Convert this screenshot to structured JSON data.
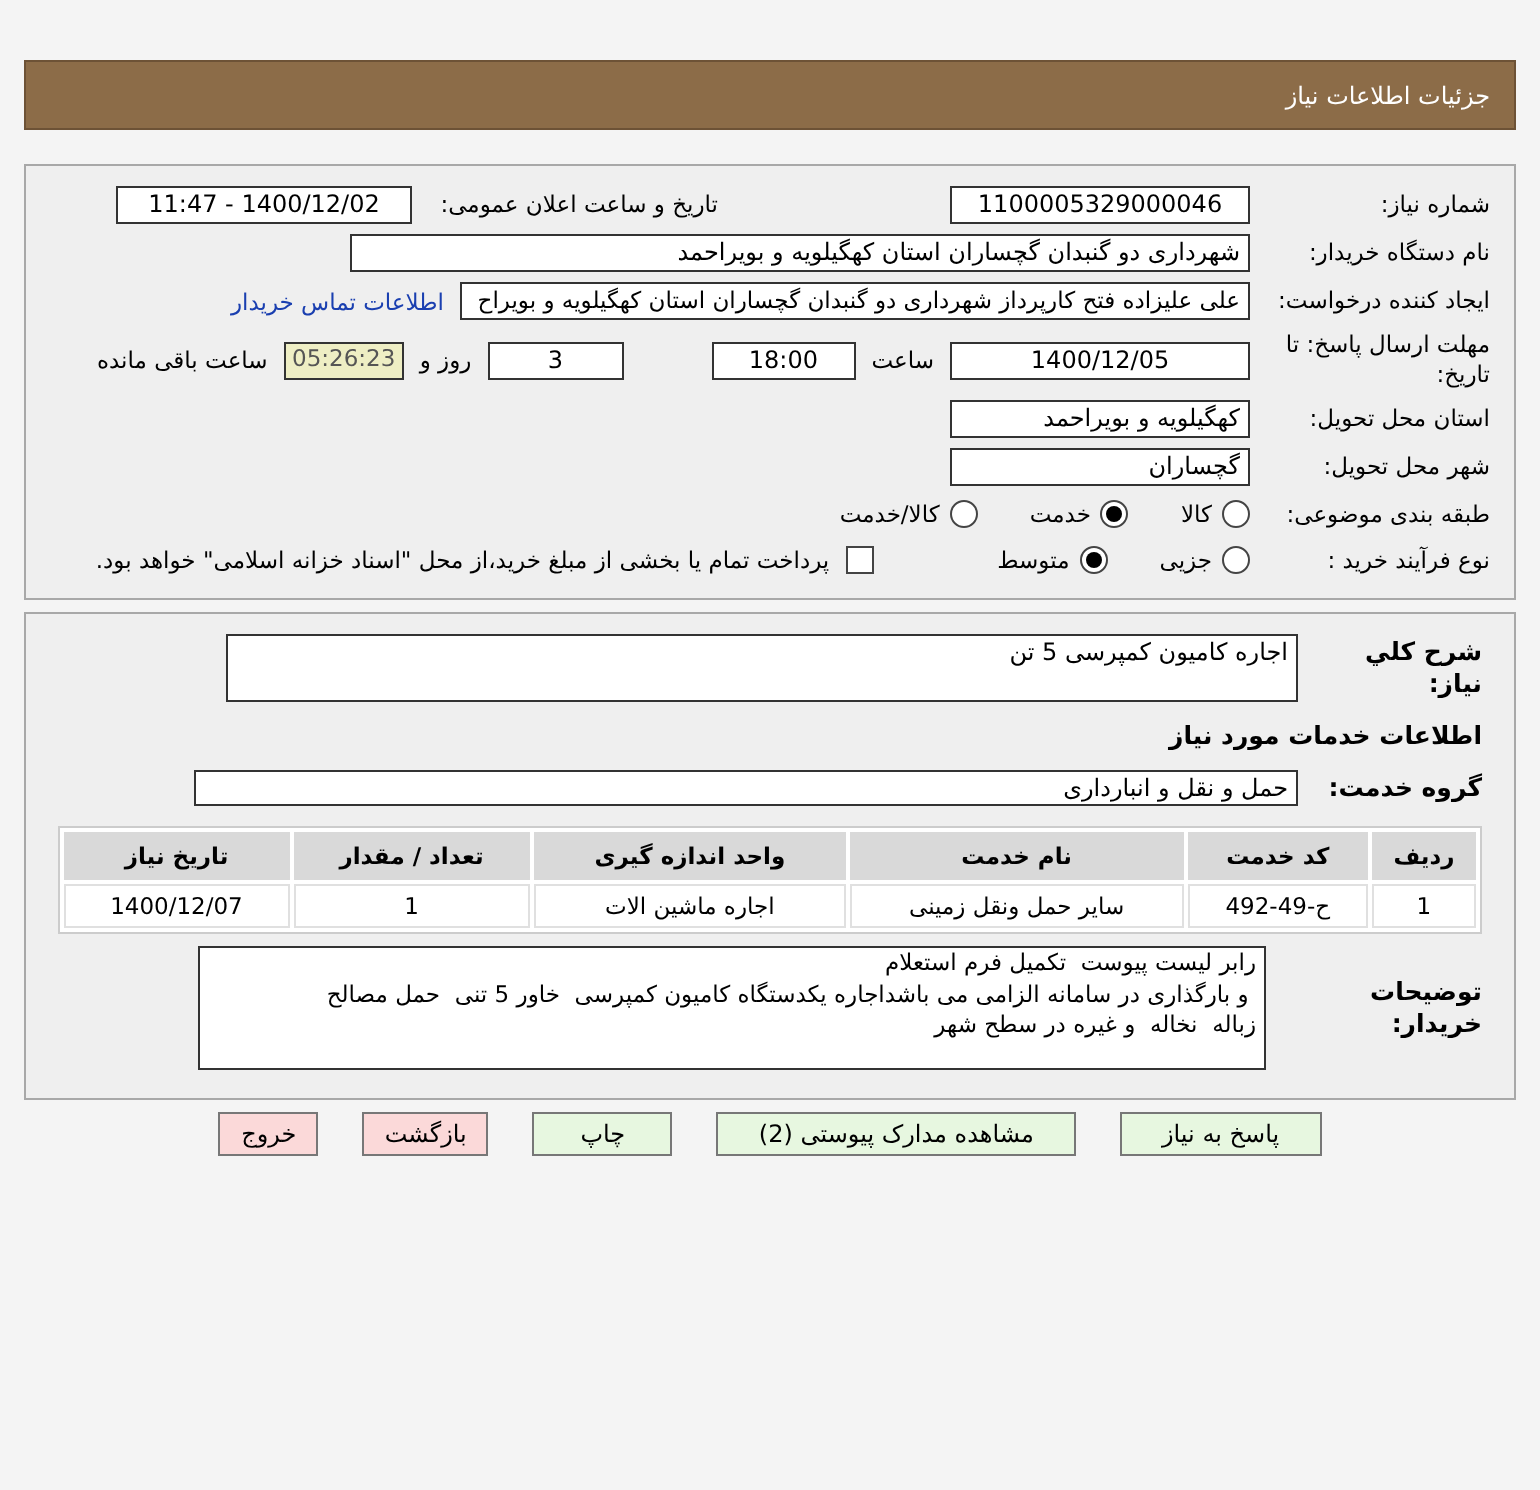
{
  "header": {
    "title": "جزئیات اطلاعات نیاز"
  },
  "need_number": {
    "label": "شماره نیاز:",
    "value": "1100005329000046"
  },
  "announce": {
    "label": "تاریخ و ساعت اعلان عمومی:",
    "value": "1400/12/02 - 11:47"
  },
  "buyer_org": {
    "label": "نام دستگاه خریدار:",
    "value": "شهرداری دو گنبدان گچساران استان کهگیلویه و بویراحمد"
  },
  "requester": {
    "label": "ایجاد کننده درخواست:",
    "value": "علی علیزاده فتح کارپرداز شهرداری دو گنبدان گچساران استان کهگیلویه و بویراح",
    "link": "اطلاعات تماس خریدار"
  },
  "deadline": {
    "label": "مهلت ارسال پاسخ: تا تاریخ:",
    "date": "1400/12/05",
    "time_label": "ساعت",
    "time": "18:00",
    "days": "3",
    "days_label": "روز و",
    "remaining": "05:26:23",
    "remaining_label": "ساعت باقی مانده"
  },
  "province": {
    "label": "استان محل تحویل:",
    "value": "کهگیلویه و بویراحمد"
  },
  "city": {
    "label": "شهر محل تحویل:",
    "value": "گچساران"
  },
  "category": {
    "label": "طبقه بندی موضوعی:",
    "options": [
      {
        "label": "کالا",
        "selected": false
      },
      {
        "label": "خدمت",
        "selected": true
      },
      {
        "label": "کالا/خدمت",
        "selected": false
      }
    ]
  },
  "process": {
    "label": "نوع فرآیند خرید :",
    "options": [
      {
        "label": "جزیی",
        "selected": false
      },
      {
        "label": "متوسط",
        "selected": true
      }
    ],
    "payment": {
      "checked": false,
      "label": "پرداخت تمام یا بخشی از مبلغ خرید،از محل \"اسناد خزانه اسلامی\" خواهد بود."
    }
  },
  "summary": {
    "label": "شرح کلي نياز:",
    "value": "اجاره کامیون کمپرسی 5 تن"
  },
  "services_title": "اطلاعات خدمات مورد نیاز",
  "service_group": {
    "label": "گروه خدمت:",
    "value": "حمل و نقل و انبارداری"
  },
  "table": {
    "columns": [
      "ردیف",
      "کد خدمت",
      "نام خدمت",
      "واحد اندازه گیری",
      "تعداد / مقدار",
      "تاریخ نیاز"
    ],
    "rows": [
      [
        "1",
        "ح-49-492",
        "سایر حمل ونقل زمینی",
        "اجاره ماشین الات",
        "1",
        "1400/12/07"
      ]
    ]
  },
  "buyer_notes": {
    "label": "توضیحات خریدار:",
    "value": "رابر لیست پیوست  تکمیل فرم استعلام\n و بارگذاری در سامانه الزامی می باشداجاره یکدستگاه کامیون کمپرسی  خاور 5 تنی  حمل مصالح\nزباله  نخاله  و غیره در سطح شهر"
  },
  "buttons": [
    {
      "label": "پاسخ به نیاز",
      "kind": "normal"
    },
    {
      "label": "مشاهده مدارک پیوستی (2)",
      "kind": "normal"
    },
    {
      "label": "چاپ",
      "kind": "normal"
    },
    {
      "label": "بازگشت",
      "kind": "danger"
    },
    {
      "label": "خروج",
      "kind": "danger"
    }
  ]
}
